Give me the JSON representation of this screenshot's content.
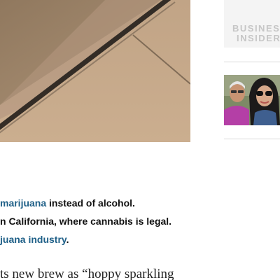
{
  "rail": {
    "logo_line1": "BUSINESS",
    "logo_line2": "INSIDER"
  },
  "article": {
    "bullet1_link": "marijuana",
    "bullet1_text": " instead of alcohol.",
    "bullet2_text": "n California, where cannabis is legal.",
    "bullet3_link": "juana industry",
    "bullet3_text": ".",
    "body_text": "ts new brew as “hoppy sparkling"
  },
  "colors": {
    "link": "#1f6088",
    "text": "#111111",
    "logo": "#c6c6c6"
  }
}
